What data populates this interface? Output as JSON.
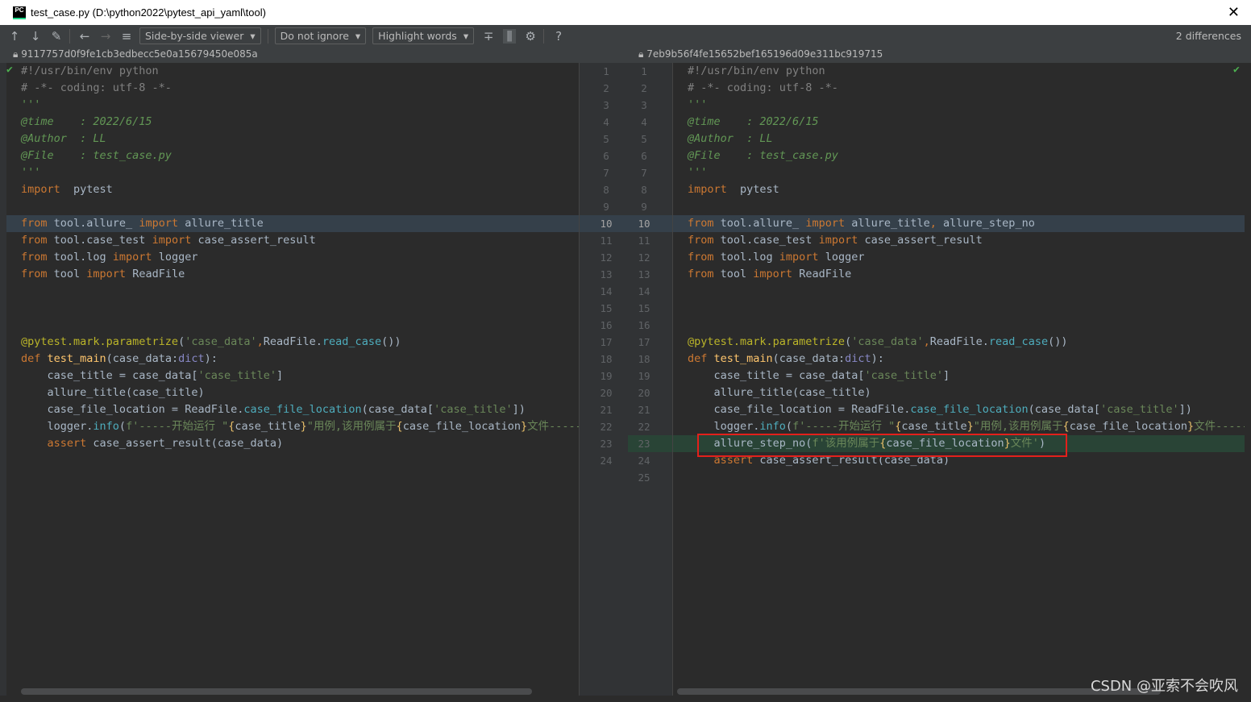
{
  "window": {
    "title": "test_case.py (D:\\python2022\\pytest_api_yaml\\tool)",
    "app_icon": "PC",
    "close_icon": "✕"
  },
  "toolbar": {
    "icons": [
      "arrow-up-icon",
      "arrow-down-icon",
      "edit-icon",
      "back-icon",
      "forward-icon",
      "list-icon"
    ],
    "viewer": "Side-by-side viewer",
    "ignore": "Do not ignore",
    "highlight": "Highlight words",
    "differences": "2 differences"
  },
  "left": {
    "hash": "9117757d0f9fe1cb3edbecc5e0a15679450e085a",
    "line_numbers": [
      1,
      2,
      3,
      4,
      5,
      6,
      7,
      8,
      9,
      10,
      11,
      12,
      13,
      14,
      15,
      16,
      17,
      18,
      19,
      20,
      21,
      22,
      23,
      24
    ],
    "lines": [
      [
        [
          "cmt",
          "#!/usr/bin/env python"
        ]
      ],
      [
        [
          "cmt",
          "# -*- coding: utf-8 -*-"
        ]
      ],
      [
        [
          "docq",
          "'''"
        ]
      ],
      [
        [
          "doc",
          "@time    : 2022/6/15"
        ]
      ],
      [
        [
          "doc",
          "@Author  : LL"
        ]
      ],
      [
        [
          "doc",
          "@File    : test_case.py"
        ]
      ],
      [
        [
          "docq",
          "'''"
        ]
      ],
      [
        [
          "kw",
          "import"
        ],
        [
          "",
          "  pytest"
        ]
      ],
      [],
      [
        [
          "kw",
          "from"
        ],
        [
          "",
          " tool.allure_ "
        ],
        [
          "kw",
          "import"
        ],
        [
          "",
          " allure_title"
        ]
      ],
      [
        [
          "kw",
          "from"
        ],
        [
          "",
          " tool.case_test "
        ],
        [
          "kw",
          "import"
        ],
        [
          "",
          " case_assert_result"
        ]
      ],
      [
        [
          "kw",
          "from"
        ],
        [
          "",
          " tool.log "
        ],
        [
          "kw",
          "import"
        ],
        [
          "",
          " logger"
        ]
      ],
      [
        [
          "kw",
          "from"
        ],
        [
          "",
          " tool "
        ],
        [
          "kw",
          "import"
        ],
        [
          "",
          " ReadFile"
        ]
      ],
      [],
      [],
      [],
      [
        [
          "dec",
          "@pytest.mark.parametrize"
        ],
        [
          "",
          "("
        ],
        [
          "str",
          "'case_data'"
        ],
        [
          "kw",
          ","
        ],
        [
          "",
          "ReadFile."
        ],
        [
          "attr",
          "read_case"
        ],
        [
          "",
          "())"
        ]
      ],
      [
        [
          "kw",
          "def"
        ],
        [
          "fn",
          " test_main"
        ],
        [
          "",
          "(case_data:"
        ],
        [
          "bi",
          "dict"
        ],
        [
          "",
          "):"
        ]
      ],
      [
        [
          "",
          "    case_title = case_data["
        ],
        [
          "str",
          "'case_title'"
        ],
        [
          "",
          "]"
        ]
      ],
      [
        [
          "",
          "    allure_title(case_title)"
        ]
      ],
      [
        [
          "",
          "    case_file_location = ReadFile."
        ],
        [
          "attr",
          "case_file_location"
        ],
        [
          "",
          "(case_data["
        ],
        [
          "str",
          "'case_title'"
        ],
        [
          "",
          "])"
        ]
      ],
      [
        [
          "",
          "    logger."
        ],
        [
          "attr",
          "info"
        ],
        [
          "",
          "("
        ],
        [
          "str",
          "f'-----开始运行 \""
        ],
        [
          "fs",
          "{"
        ],
        [
          "",
          "case_title"
        ],
        [
          "fs",
          "}"
        ],
        [
          "str",
          "\"用例,该用例属于"
        ],
        [
          "fs",
          "{"
        ],
        [
          "",
          "case_file_location"
        ],
        [
          "fs",
          "}"
        ],
        [
          "str",
          "文件-----')"
        ]
      ],
      [
        [
          "kw",
          "    assert"
        ],
        [
          "",
          " case_assert_result(case_data)"
        ]
      ],
      []
    ]
  },
  "right": {
    "hash": "7eb9b56f4fe15652bef165196d09e311bc919715",
    "line_numbers": [
      1,
      2,
      3,
      4,
      5,
      6,
      7,
      8,
      9,
      10,
      11,
      12,
      13,
      14,
      15,
      16,
      17,
      18,
      19,
      20,
      21,
      22,
      23,
      24,
      25
    ],
    "lines": [
      [
        [
          "cmt",
          "#!/usr/bin/env python"
        ]
      ],
      [
        [
          "cmt",
          "# -*- coding: utf-8 -*-"
        ]
      ],
      [
        [
          "docq",
          "'''"
        ]
      ],
      [
        [
          "doc",
          "@time    : 2022/6/15"
        ]
      ],
      [
        [
          "doc",
          "@Author  : LL"
        ]
      ],
      [
        [
          "doc",
          "@File    : test_case.py"
        ]
      ],
      [
        [
          "docq",
          "'''"
        ]
      ],
      [
        [
          "kw",
          "import"
        ],
        [
          "",
          "  pytest"
        ]
      ],
      [],
      [
        [
          "kw",
          "from"
        ],
        [
          "",
          " tool.allure_ "
        ],
        [
          "kw",
          "import"
        ],
        [
          "",
          " allure_title"
        ],
        [
          "kw",
          ","
        ],
        [
          "",
          " allure_step_no"
        ]
      ],
      [
        [
          "kw",
          "from"
        ],
        [
          "",
          " tool.case_test "
        ],
        [
          "kw",
          "import"
        ],
        [
          "",
          " case_assert_result"
        ]
      ],
      [
        [
          "kw",
          "from"
        ],
        [
          "",
          " tool.log "
        ],
        [
          "kw",
          "import"
        ],
        [
          "",
          " logger"
        ]
      ],
      [
        [
          "kw",
          "from"
        ],
        [
          "",
          " tool "
        ],
        [
          "kw",
          "import"
        ],
        [
          "",
          " ReadFile"
        ]
      ],
      [],
      [],
      [],
      [
        [
          "dec",
          "@pytest.mark.parametrize"
        ],
        [
          "",
          "("
        ],
        [
          "str",
          "'case_data'"
        ],
        [
          "kw",
          ","
        ],
        [
          "",
          "ReadFile."
        ],
        [
          "attr",
          "read_case"
        ],
        [
          "",
          "())"
        ]
      ],
      [
        [
          "kw",
          "def"
        ],
        [
          "fn",
          " test_main"
        ],
        [
          "",
          "(case_data:"
        ],
        [
          "bi",
          "dict"
        ],
        [
          "",
          "):"
        ]
      ],
      [
        [
          "",
          "    case_title = case_data["
        ],
        [
          "str",
          "'case_title'"
        ],
        [
          "",
          "]"
        ]
      ],
      [
        [
          "",
          "    allure_title(case_title)"
        ]
      ],
      [
        [
          "",
          "    case_file_location = ReadFile."
        ],
        [
          "attr",
          "case_file_location"
        ],
        [
          "",
          "(case_data["
        ],
        [
          "str",
          "'case_title'"
        ],
        [
          "",
          "])"
        ]
      ],
      [
        [
          "",
          "    logger."
        ],
        [
          "attr",
          "info"
        ],
        [
          "",
          "("
        ],
        [
          "str",
          "f'-----开始运行 \""
        ],
        [
          "fs",
          "{"
        ],
        [
          "",
          "case_title"
        ],
        [
          "fs",
          "}"
        ],
        [
          "str",
          "\"用例,该用例属于"
        ],
        [
          "fs",
          "{"
        ],
        [
          "",
          "case_file_location"
        ],
        [
          "fs",
          "}"
        ],
        [
          "str",
          "文件-----')"
        ]
      ],
      [
        [
          "",
          "    allure_step_no("
        ],
        [
          "str",
          "f'该用例属于"
        ],
        [
          "fs",
          "{"
        ],
        [
          "",
          "case_file_location"
        ],
        [
          "fs",
          "}"
        ],
        [
          "str",
          "文件'"
        ],
        [
          "",
          ")"
        ]
      ],
      [
        [
          "kw",
          "    assert"
        ],
        [
          "",
          " case_assert_result(case_data)"
        ]
      ],
      []
    ]
  },
  "watermark": "CSDN @亚索不会吹风",
  "colors": {
    "background": "#2b2b2b",
    "modified": "#35404a",
    "inserted": "#294436",
    "highlight_box": "#e3201b"
  }
}
